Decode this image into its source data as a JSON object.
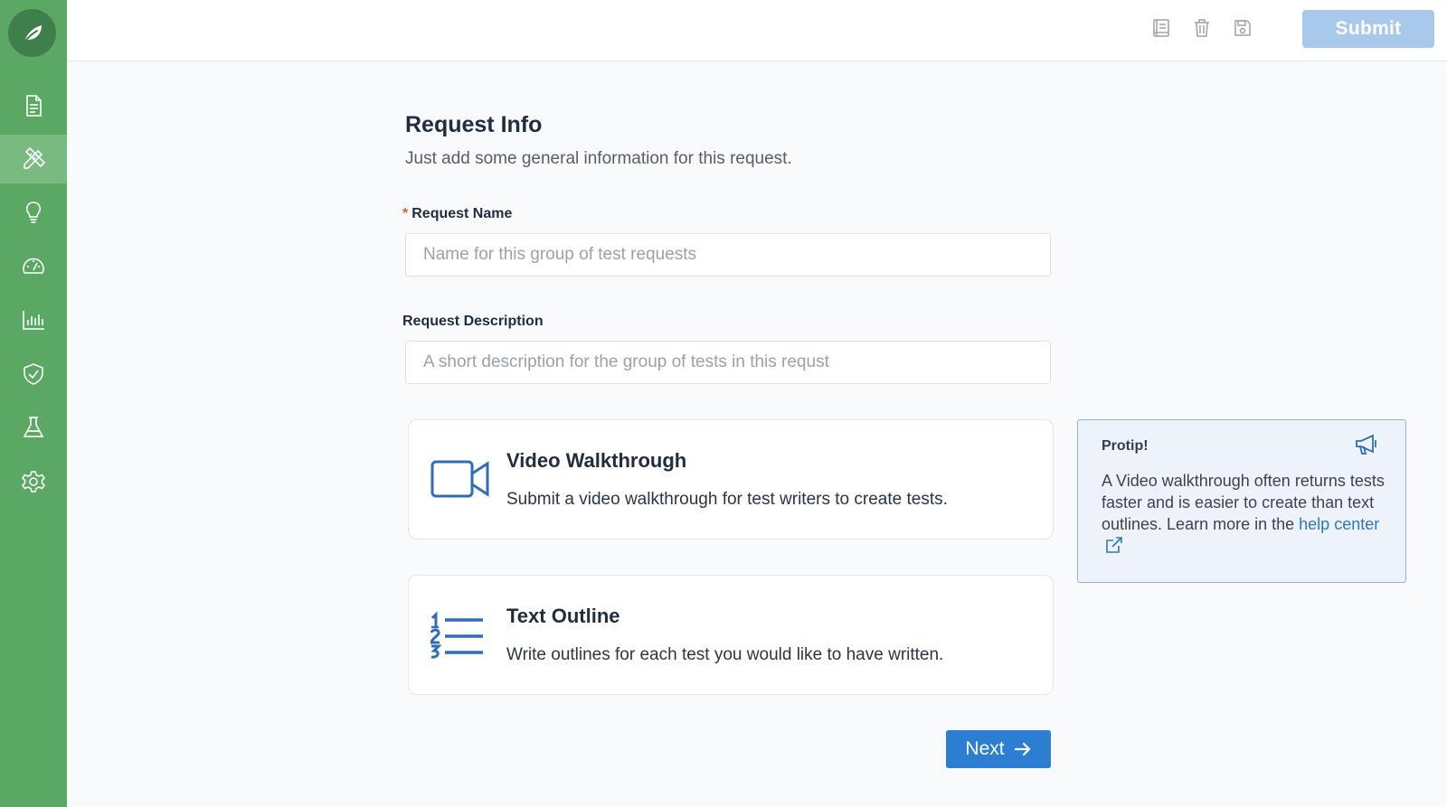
{
  "sidebar": {
    "logo": "leaf-icon",
    "items": [
      {
        "id": "documents",
        "icon": "document-icon",
        "active": false
      },
      {
        "id": "design",
        "icon": "pencil-ruler-icon",
        "active": true
      },
      {
        "id": "ideas",
        "icon": "lightbulb-icon",
        "active": false
      },
      {
        "id": "dashboard",
        "icon": "speedometer-icon",
        "active": false
      },
      {
        "id": "reports",
        "icon": "bar-chart-icon",
        "active": false
      },
      {
        "id": "security",
        "icon": "shield-check-icon",
        "active": false
      },
      {
        "id": "lab",
        "icon": "flask-icon",
        "active": false
      },
      {
        "id": "settings",
        "icon": "gear-icon",
        "active": false
      }
    ]
  },
  "toolbar": {
    "icons": [
      "notebook-icon",
      "trash-icon",
      "save-icon"
    ],
    "submit_label": "Submit"
  },
  "form": {
    "title": "Request Info",
    "subtitle": "Just add some general information for this request.",
    "name_label": "Request Name",
    "name_required_mark": "*",
    "name_placeholder": "Name for this group of test requests",
    "description_label": "Request Description",
    "description_placeholder": "A short description for the group of tests in this requst"
  },
  "options": [
    {
      "title": "Video Walkthrough",
      "description": "Submit a video walkthrough for test writers to create tests.",
      "icon": "video-camera-icon"
    },
    {
      "title": "Text Outline",
      "description": "Write outlines for each test you would like to have written.",
      "icon": "numbered-list-icon"
    }
  ],
  "protip": {
    "title": "Protip!",
    "body": "A Video walkthrough often returns tests faster and is easier to create than text outlines. Learn more in the",
    "link_text": "help center",
    "icon": "megaphone-icon"
  },
  "next_label": "Next",
  "colors": {
    "sidebar": "#5aa864",
    "sidebar_active": "#79ba81",
    "primary": "#2d7dd2",
    "submit_disabled": "#a9c9ea",
    "accent_icon": "#2f6db5"
  }
}
